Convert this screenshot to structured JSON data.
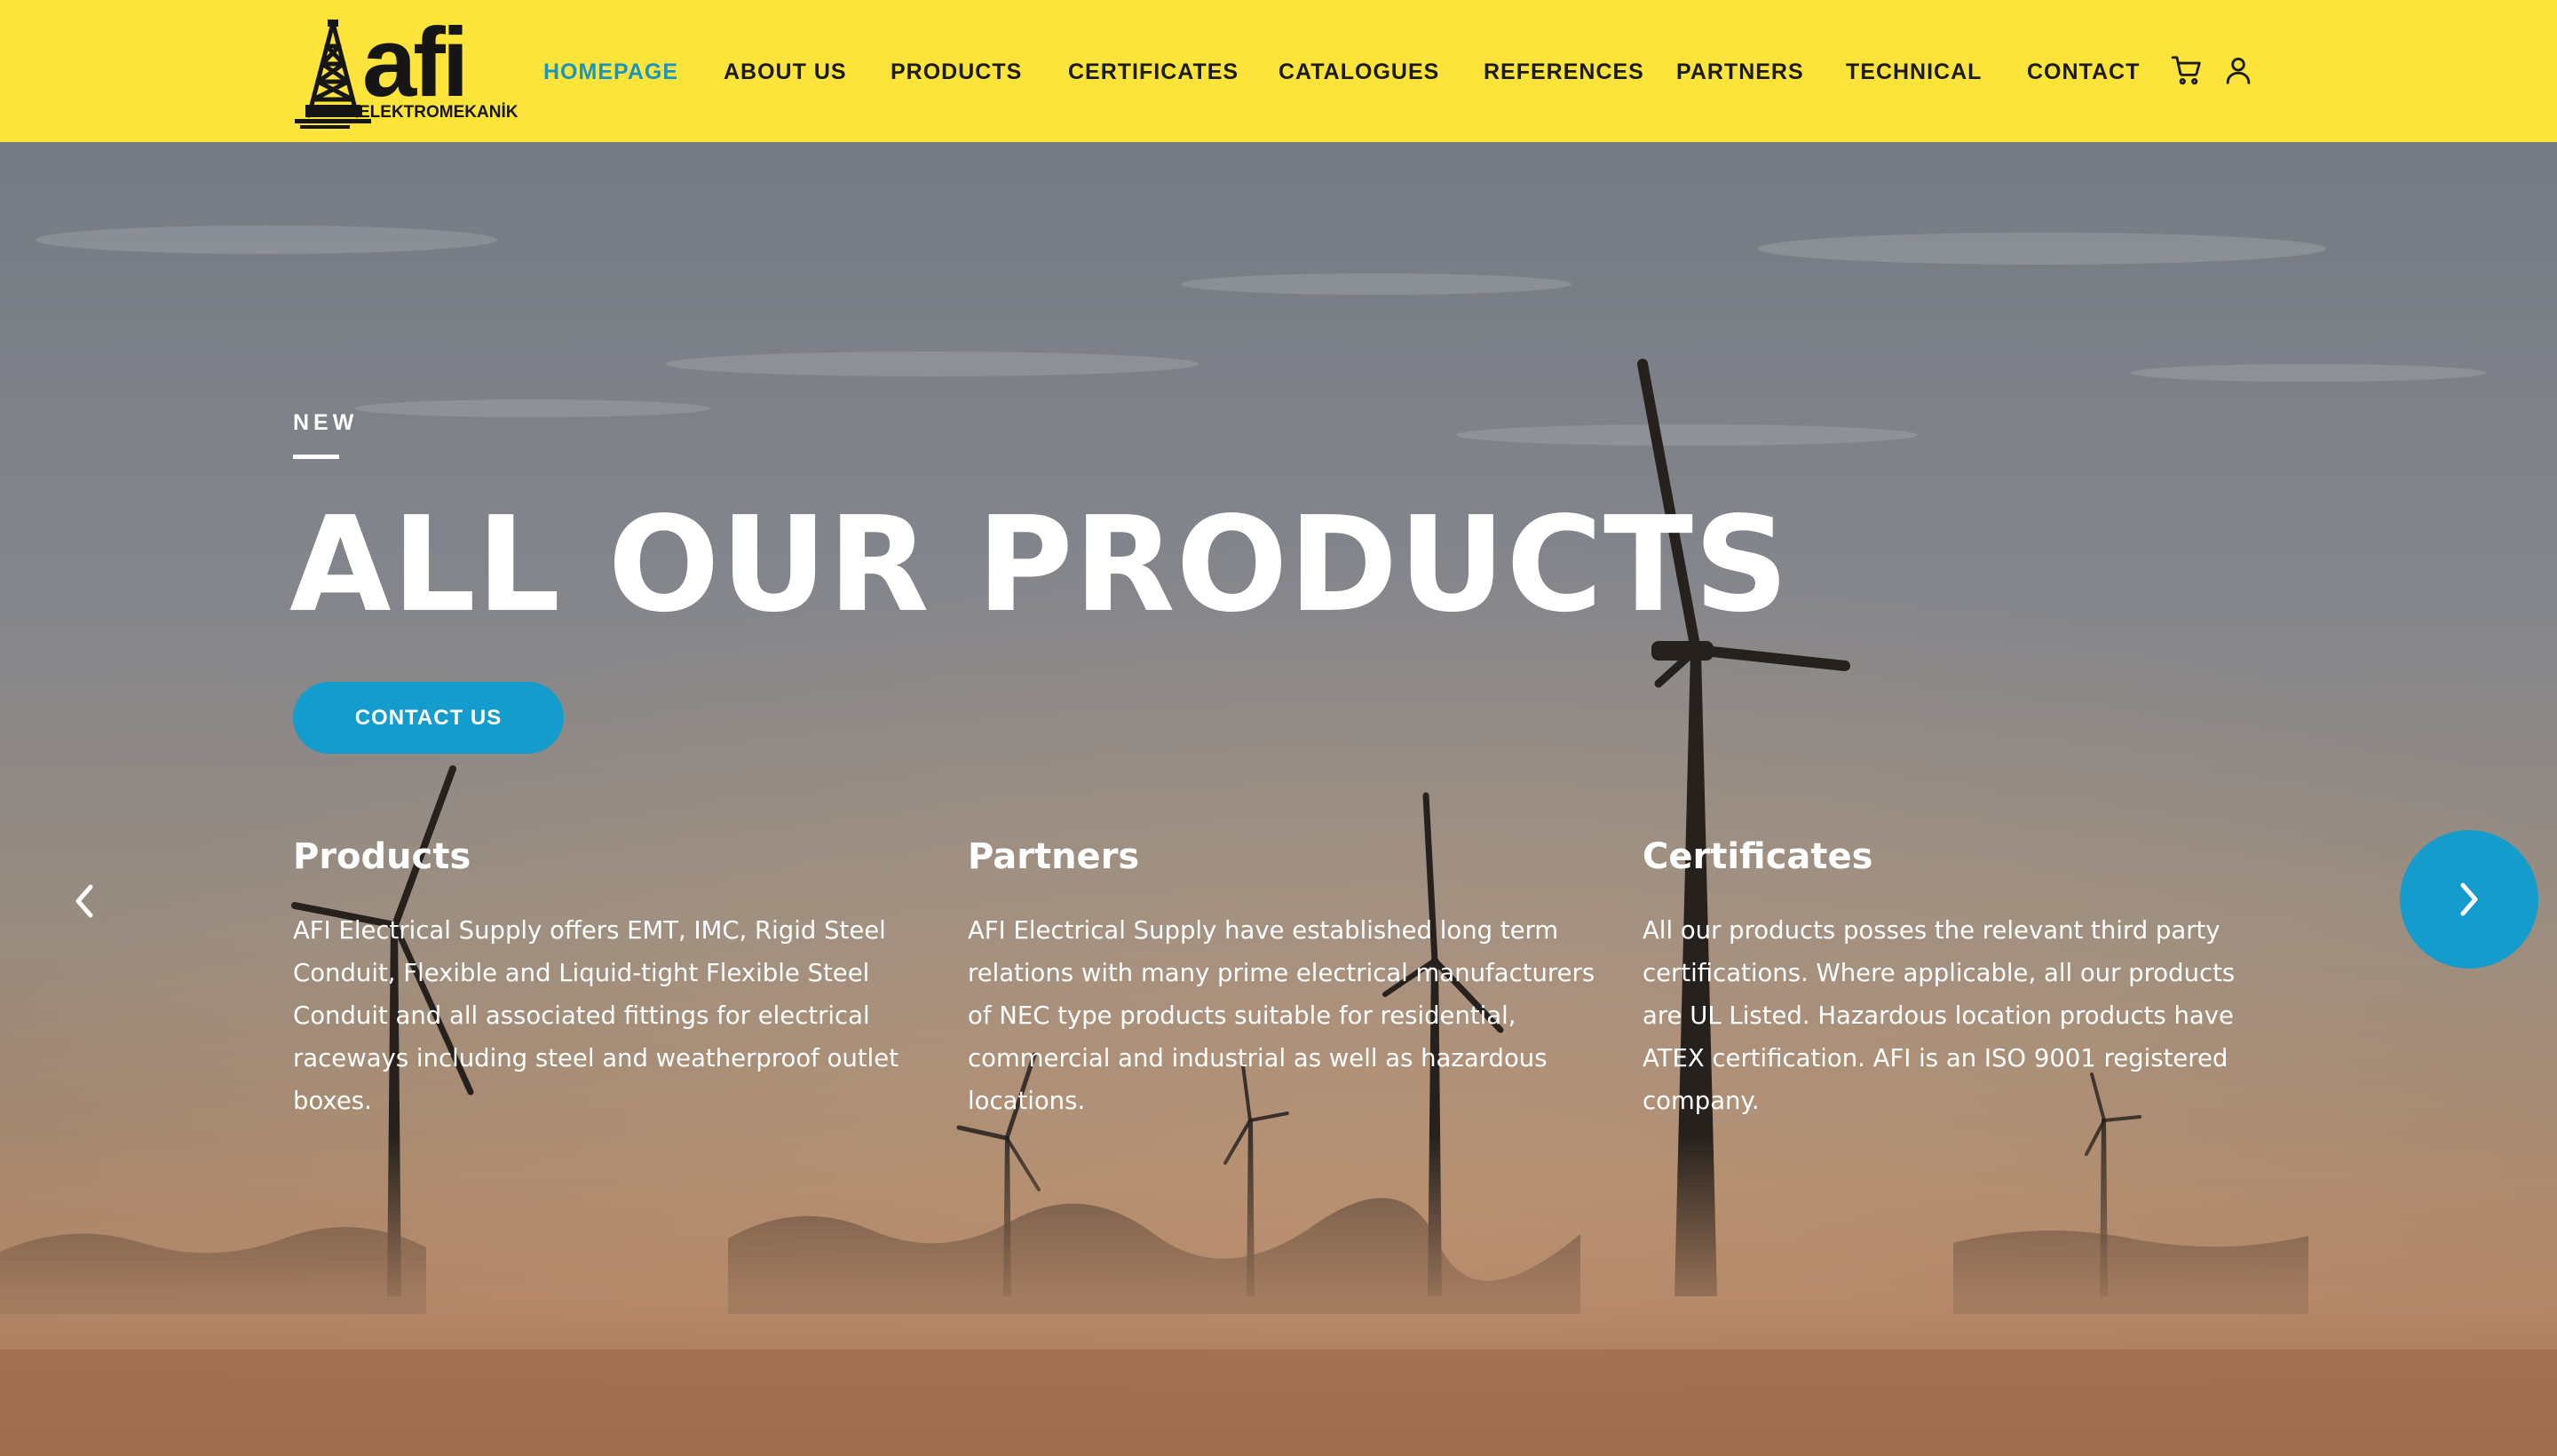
{
  "brand": {
    "logo_text": "afi",
    "logo_subtext": "ELEKTROMEKANİK"
  },
  "nav": {
    "items": [
      {
        "label": "HOMEPAGE",
        "active": true
      },
      {
        "label": "ABOUT US"
      },
      {
        "label": "PRODUCTS"
      },
      {
        "label": "CERTIFICATES"
      },
      {
        "label": "CATALOGUES"
      },
      {
        "label": "REFERENCES"
      },
      {
        "label": "PARTNERS"
      },
      {
        "label": "TECHNICAL"
      },
      {
        "label": "CONTACT"
      }
    ],
    "icons": [
      "cart-icon",
      "user-icon"
    ]
  },
  "hero": {
    "eyebrow": "NEW",
    "title": "ALL OUR PRODUCTS",
    "cta_label": "CONTACT US",
    "columns": [
      {
        "title": "Products",
        "text": "AFI Electrical Supply offers EMT, IMC, Rigid Steel Conduit, Flexible and Liquid-tight Flexible Steel Conduit and all associated fittings for electrical raceways including steel and weatherproof outlet boxes."
      },
      {
        "title": "Partners",
        "text": "AFI Electrical Supply have established long term relations with many prime electrical manufacturers of NEC type products suitable for residential, commercial and industrial as well as hazardous locations."
      },
      {
        "title": "Certificates",
        "text": "All our products posses the relevant third party certifications. Where applicable, all our products are UL Listed. Hazardous location products have ATEX certification. AFI is an ISO 9001 registered company."
      }
    ]
  },
  "slider": {
    "prev_icon": "chevron-left-icon",
    "next_icon": "chevron-right-icon"
  },
  "colors": {
    "header_bg": "#fde43a",
    "accent": "#139ccc",
    "active_nav": "#1a96bd",
    "text_dark": "#1b1b1b"
  }
}
